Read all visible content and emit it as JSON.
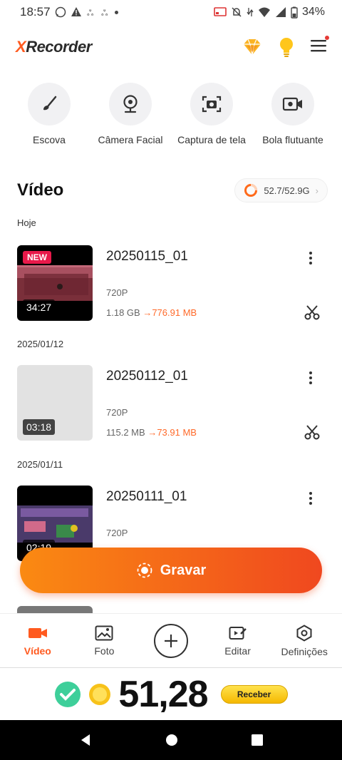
{
  "status": {
    "time": "18:57",
    "battery": "34%"
  },
  "app": {
    "logo_x": "X",
    "logo_rest": "Recorder"
  },
  "tools": [
    {
      "label": "Escova",
      "icon": "brush-icon"
    },
    {
      "label": "Câmera Facial",
      "icon": "webcam-icon"
    },
    {
      "label": "Captura de tela",
      "icon": "screenshot-icon"
    },
    {
      "label": "Bola flutuante",
      "icon": "floating-ball-icon"
    }
  ],
  "section": {
    "title": "Vídeo",
    "storage": "52.7/52.9G"
  },
  "videos": [
    {
      "date": "Hoje",
      "name": "20250115_01",
      "resolution": "720P",
      "size_old": "1.18 GB",
      "size_new": "776.91 MB",
      "duration": "34:27",
      "badge": "NEW"
    },
    {
      "date": "2025/01/12",
      "name": "20250112_01",
      "resolution": "720P",
      "size_old": "115.2 MB",
      "size_new": "73.91 MB",
      "duration": "03:18"
    },
    {
      "date": "2025/01/11",
      "name": "20250111_01",
      "resolution": "720P",
      "duration": "02:19"
    }
  ],
  "record_button": {
    "label": "Gravar"
  },
  "nav": [
    {
      "label": "Vídeo",
      "icon": "video-camera-icon",
      "active": true
    },
    {
      "label": "Foto",
      "icon": "photo-icon"
    },
    {
      "label": "",
      "icon": "plus-icon"
    },
    {
      "label": "Editar",
      "icon": "edit-icon"
    },
    {
      "label": "Definições",
      "icon": "settings-icon"
    }
  ],
  "ad": {
    "amount": "51,28",
    "button": "Receber"
  },
  "colors": {
    "accent": "#ff5a1f",
    "record_start": "#fa8a12",
    "record_end": "#f0481f"
  }
}
